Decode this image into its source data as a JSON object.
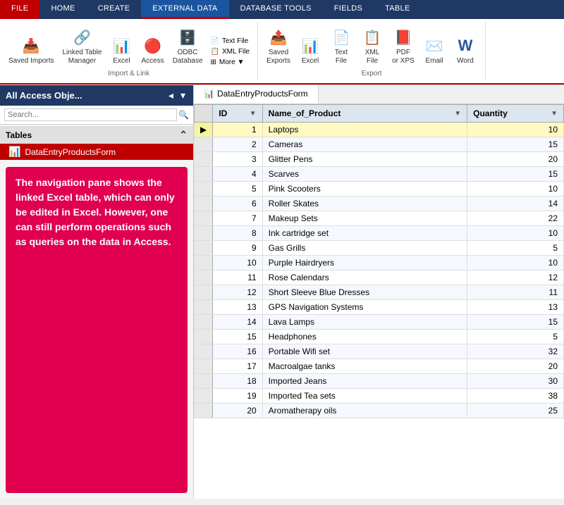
{
  "ribbon": {
    "tabs": [
      {
        "id": "file",
        "label": "FILE",
        "active": false,
        "style": "file"
      },
      {
        "id": "home",
        "label": "HOME",
        "active": false
      },
      {
        "id": "create",
        "label": "CREATE",
        "active": false
      },
      {
        "id": "external-data",
        "label": "EXTERNAL DATA",
        "active": true
      },
      {
        "id": "database-tools",
        "label": "DATABASE TOOLS",
        "active": false
      },
      {
        "id": "fields",
        "label": "FIELDS",
        "active": false
      },
      {
        "id": "table",
        "label": "TABLE",
        "active": false
      }
    ],
    "import_group": {
      "label": "Import & Link",
      "buttons": [
        {
          "id": "saved-imports",
          "label": "Saved\nImports",
          "icon": "📥"
        },
        {
          "id": "linked-table-manager",
          "label": "Linked Table\nManager",
          "icon": "🔗"
        },
        {
          "id": "excel-import",
          "label": "Excel",
          "icon": "📊"
        },
        {
          "id": "access-import",
          "label": "Access",
          "icon": "🔴"
        },
        {
          "id": "odbc",
          "label": "ODBC\nDatabase",
          "icon": "🗄️"
        }
      ],
      "small_buttons": [
        {
          "id": "text-file",
          "label": "Text File"
        },
        {
          "id": "xml-file",
          "label": "XML File"
        },
        {
          "id": "more",
          "label": "More ▼"
        }
      ]
    },
    "export_group": {
      "label": "Export",
      "buttons": [
        {
          "id": "saved-exports",
          "label": "Saved\nExports",
          "icon": "📤"
        },
        {
          "id": "excel-export",
          "label": "Excel",
          "icon": "📊"
        },
        {
          "id": "text-file-export",
          "label": "Text\nFile",
          "icon": "📄"
        },
        {
          "id": "xml-file-export",
          "label": "XML\nFile",
          "icon": "📋"
        },
        {
          "id": "pdf-export",
          "label": "PDF\nor XPS",
          "icon": "📕"
        },
        {
          "id": "email-export",
          "label": "Email",
          "icon": "✉️"
        },
        {
          "id": "word-export",
          "label": "W",
          "icon": "W"
        }
      ]
    }
  },
  "nav_pane": {
    "title": "All Access Obje...",
    "search_placeholder": "Search...",
    "sections": [
      {
        "label": "Tables",
        "items": [
          {
            "id": "data-entry-products-form",
            "label": "DataEntryProductsForm",
            "icon": "📊",
            "selected": true
          }
        ]
      }
    ],
    "callout_text": "The navigation pane shows the linked Excel table, which can only be edited in Excel. However, one can still perform operations such as queries on the data in Access."
  },
  "data_table": {
    "tab_label": "DataEntryProductsForm",
    "columns": [
      {
        "id": "id",
        "label": "ID",
        "has_sort": true
      },
      {
        "id": "name_of_product",
        "label": "Name_of_Product",
        "has_sort": true
      },
      {
        "id": "quantity",
        "label": "Quantity",
        "has_sort": true
      }
    ],
    "rows": [
      {
        "id": 1,
        "name": "Laptops",
        "qty": 10,
        "selected": true
      },
      {
        "id": 2,
        "name": "Cameras",
        "qty": 15
      },
      {
        "id": 3,
        "name": "Glitter Pens",
        "qty": 20
      },
      {
        "id": 4,
        "name": "Scarves",
        "qty": 15
      },
      {
        "id": 5,
        "name": "Pink Scooters",
        "qty": 10
      },
      {
        "id": 6,
        "name": "Roller Skates",
        "qty": 14
      },
      {
        "id": 7,
        "name": "Makeup Sets",
        "qty": 22
      },
      {
        "id": 8,
        "name": "Ink cartridge set",
        "qty": 10
      },
      {
        "id": 9,
        "name": "Gas Grills",
        "qty": 5
      },
      {
        "id": 10,
        "name": "Purple Hairdryers",
        "qty": 10
      },
      {
        "id": 11,
        "name": "Rose Calendars",
        "qty": 12
      },
      {
        "id": 12,
        "name": "Short Sleeve Blue Dresses",
        "qty": 11
      },
      {
        "id": 13,
        "name": "GPS Navigation Systems",
        "qty": 13
      },
      {
        "id": 14,
        "name": "Lava Lamps",
        "qty": 15
      },
      {
        "id": 15,
        "name": "Headphones",
        "qty": 5
      },
      {
        "id": 16,
        "name": "Portable Wifi set",
        "qty": 32
      },
      {
        "id": 17,
        "name": "Macroalgae tanks",
        "qty": 20
      },
      {
        "id": 18,
        "name": "Imported Jeans",
        "qty": 30
      },
      {
        "id": 19,
        "name": "Imported Tea sets",
        "qty": 38
      },
      {
        "id": 20,
        "name": "Aromatherapy oils",
        "qty": 25
      }
    ]
  }
}
